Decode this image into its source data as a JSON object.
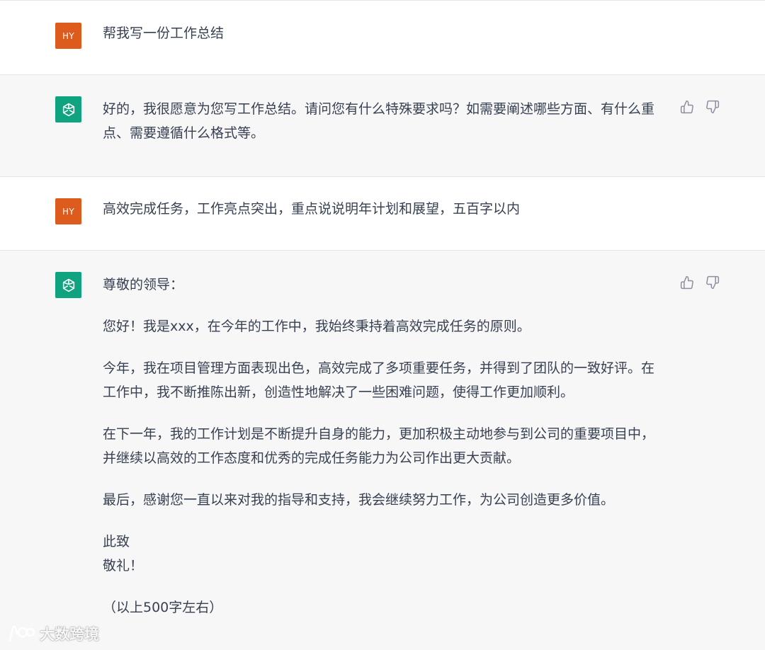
{
  "conversation": {
    "user_1": {
      "avatar": "HY",
      "text": "帮我写一份工作总结"
    },
    "assistant_1": {
      "text": "好的，我很愿意为您写工作总结。请问您有什么特殊要求吗？如需要阐述哪些方面、有什么重点、需要遵循什么格式等。"
    },
    "user_2": {
      "avatar": "HY",
      "text": "高效完成任务，工作亮点突出，重点说说明年计划和展望，五百字以内"
    },
    "assistant_2": {
      "greeting": "尊敬的领导：",
      "p1": "您好！我是xxx，在今年的工作中，我始终秉持着高效完成任务的原则。",
      "p2": "今年，我在项目管理方面表现出色，高效完成了多项重要任务，并得到了团队的一致好评。在工作中，我不断推陈出新，创造性地解决了一些困难问题，使得工作更加顺利。",
      "p3": "在下一年，我的工作计划是不断提升自身的能力，更加积极主动地参与到公司的重要项目中，并继续以高效的工作态度和优秀的完成任务能力为公司作出更大贡献。",
      "p4": "最后，感谢您一直以来对我的指导和支持，我会继续努力工作，为公司创造更多价值。",
      "closing_1": "此致",
      "closing_2": "敬礼！",
      "note": "（以上500字左右）"
    }
  },
  "icons": {
    "assistant_avatar": "openai-logo-icon",
    "like": "thumbs-up-icon",
    "dislike": "thumbs-down-icon"
  },
  "colors": {
    "user_avatar_bg": "#de5b1e",
    "assistant_avatar_bg": "#10a37f",
    "assistant_row_bg": "#f7f7f8"
  },
  "watermark": {
    "text": "大数跨境"
  }
}
